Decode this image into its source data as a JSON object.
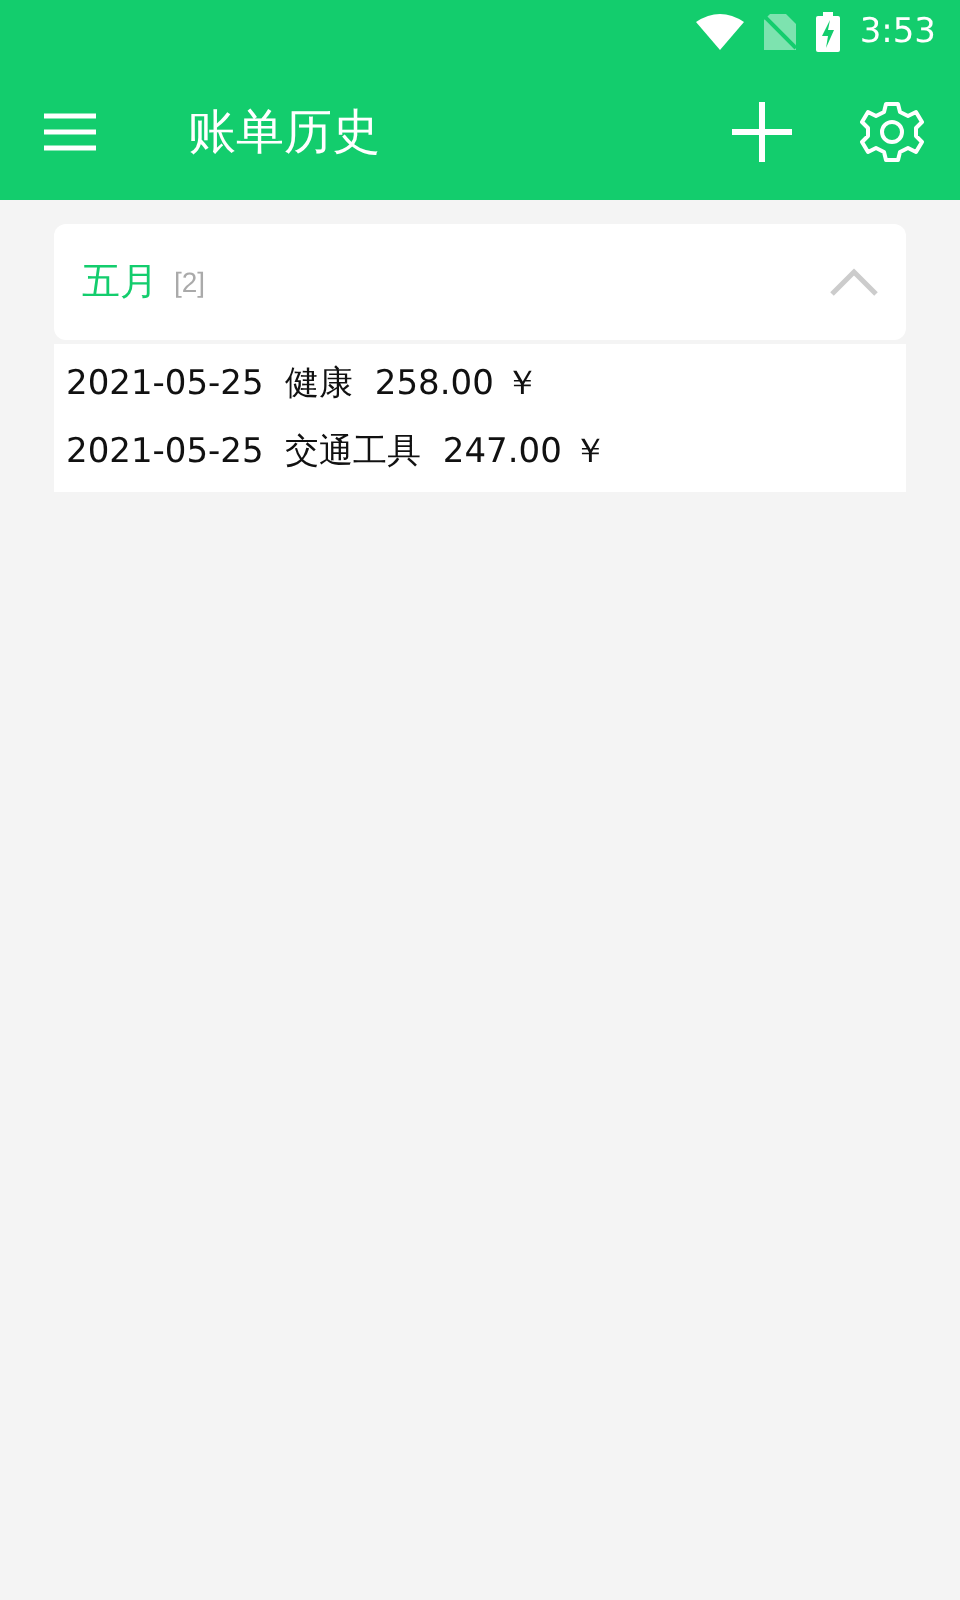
{
  "status_bar": {
    "time": "3:53"
  },
  "app_bar": {
    "title": "账单历史"
  },
  "groups": [
    {
      "title": "五月",
      "count": "[2]",
      "expanded": true,
      "entries": [
        {
          "text": "2021-05-25  健康  258.00 ￥"
        },
        {
          "text": "2021-05-25  交通工具  247.00 ￥"
        }
      ]
    }
  ]
}
